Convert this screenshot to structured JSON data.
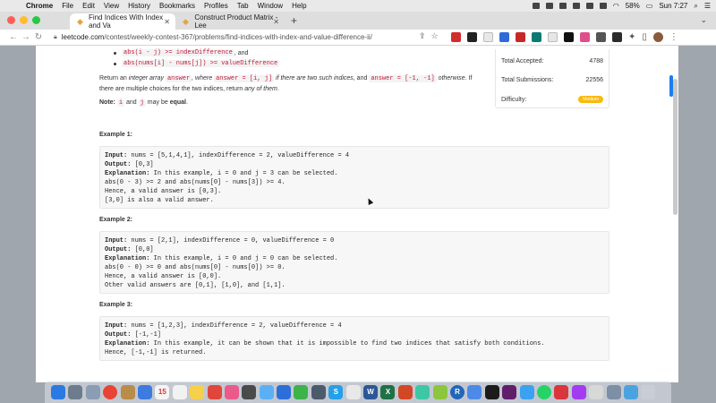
{
  "menubar": {
    "app": "Chrome",
    "items": [
      "File",
      "Edit",
      "View",
      "History",
      "Bookmarks",
      "Profiles",
      "Tab",
      "Window",
      "Help"
    ],
    "battery": "58%",
    "clock": "Sun 7:27"
  },
  "tabs": [
    {
      "title": "Find Indices With Index and Va",
      "active": true
    },
    {
      "title": "Construct Product Matrix - Lee",
      "active": false
    }
  ],
  "address": {
    "host": "leetcode.com",
    "path": "/contest/weekly-contest-367/problems/find-indices-with-index-and-value-difference-ii/"
  },
  "problem": {
    "bullet1_code": "abs(i - j) >= indexDifference",
    "bullet1_suffix": ", and",
    "bullet2_code": "abs(nums[i] - nums[j]) >= valueDifference",
    "ret_1": "Return an ",
    "ret_2": "integer array",
    "ret_code1": "answer",
    "ret_3": ", where ",
    "ret_code2": "answer = [i, j]",
    "ret_4": " if there are two such indices",
    "ret_5": ", and ",
    "ret_code3": "answer = [-1, -1]",
    "ret_6": " otherwise",
    "ret_7": ". If there are multiple choices for the two indices, return ",
    "ret_8": "any of them",
    "ret_9": ".",
    "note_label": "Note:",
    "note_code1": "i",
    "note_and": "and",
    "note_code2": "j",
    "note_text": "may be",
    "note_bold": "equal",
    "note_end": "."
  },
  "examples": [
    {
      "label": "Example 1:",
      "input_label": "Input:",
      "input": " nums = [5,1,4,1], indexDifference = 2, valueDifference = 4",
      "output_label": "Output:",
      "output": " [0,3]",
      "expl_label": "Explanation:",
      "expl": " In this example, i = 0 and j = 3 can be selected.",
      "extra": [
        "abs(0 - 3) >= 2 and abs(nums[0] - nums[3]) >= 4.",
        "Hence, a valid answer is [0,3].",
        "[3,0] is also a valid answer."
      ]
    },
    {
      "label": "Example 2:",
      "input_label": "Input:",
      "input": " nums = [2,1], indexDifference = 0, valueDifference = 0",
      "output_label": "Output:",
      "output": " [0,0]",
      "expl_label": "Explanation:",
      "expl": " In this example, i = 0 and j = 0 can be selected.",
      "extra": [
        "abs(0 - 0) >= 0 and abs(nums[0] - nums[0]) >= 0.",
        "Hence, a valid answer is [0,0].",
        "Other valid answers are [0,1], [1,0], and [1,1]."
      ]
    },
    {
      "label": "Example 3:",
      "input_label": "Input:",
      "input": " nums = [1,2,3], indexDifference = 2, valueDifference = 4",
      "output_label": "Output:",
      "output": " [-1,-1]",
      "expl_label": "Explanation:",
      "expl": " In this example, it can be shown that it is impossible to find two indices that satisfy both conditions.",
      "extra": [
        "Hence, [-1,-1] is returned."
      ]
    }
  ],
  "stats": {
    "accepted_label": "Total Accepted:",
    "accepted": "4788",
    "submissions_label": "Total Submissions:",
    "submissions": "22556",
    "difficulty_label": "Difficulty:",
    "difficulty": "Medium"
  },
  "colors": {
    "accent": "#1d7cf2",
    "medium": "#fbb80e",
    "code_red": "#c41a3a"
  }
}
